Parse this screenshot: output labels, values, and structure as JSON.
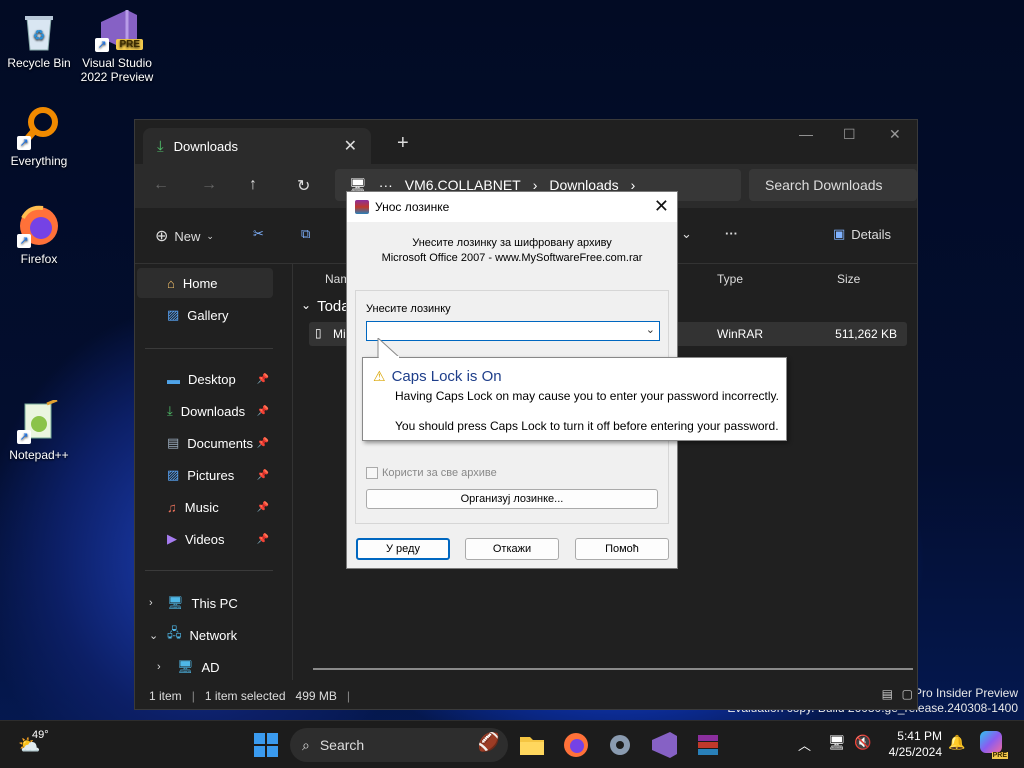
{
  "desktop": {
    "icons": [
      {
        "label": "Recycle Bin"
      },
      {
        "label": "Visual Studio 2022 Preview"
      },
      {
        "label": "Everything"
      },
      {
        "label": "Firefox"
      },
      {
        "label": "Notepad++"
      }
    ],
    "vs_badge": "PRE",
    "watermark_line1": "Pro Insider Preview",
    "watermark_line2": "Evaluation copy. Build 26080.ge_release.240308-1400"
  },
  "explorer": {
    "tab_title": "Downloads",
    "breadcrumbs": [
      "VM6.COLLABNET",
      "Downloads"
    ],
    "search_placeholder": "Search Downloads",
    "toolbar": {
      "new_label": "New",
      "details_label": "Details"
    },
    "nav": {
      "home": "Home",
      "gallery": "Gallery",
      "pinned": [
        "Desktop",
        "Downloads",
        "Documents",
        "Pictures",
        "Music",
        "Videos"
      ],
      "this_pc": "This PC",
      "network": "Network",
      "ad": "AD"
    },
    "columns": {
      "name": "Nam",
      "type": "Type",
      "size": "Size"
    },
    "group_label": "Toda",
    "file": {
      "name": "Mi",
      "type": "WinRAR",
      "size": "511,262 KB"
    },
    "status": {
      "count": "1 item",
      "selected": "1 item selected",
      "size": "499 MB"
    }
  },
  "dialog": {
    "title": "Унос лозинке",
    "prompt_line1": "Унесите лозинку за шифровану архиву",
    "prompt_line2": "Microsoft Office 2007 - www.MySoftwareFree.com.rar",
    "field_label": "Унесите лозинку",
    "password_value": "",
    "checkbox_label": "Користи за све архиве",
    "organize_button": "Организуј лозинке...",
    "ok_button": "У реду",
    "cancel_button": "Откажи",
    "help_button": "Помоћ"
  },
  "tooltip": {
    "title": "Caps Lock is On",
    "line1": "Having Caps Lock on may cause you to enter your password incorrectly.",
    "line2": "You should press Caps Lock to turn it off before entering your password."
  },
  "taskbar": {
    "weather_temp": "49°",
    "search_label": "Search",
    "time": "5:41 PM",
    "date": "4/25/2024",
    "copilot_badge": "PRE"
  }
}
